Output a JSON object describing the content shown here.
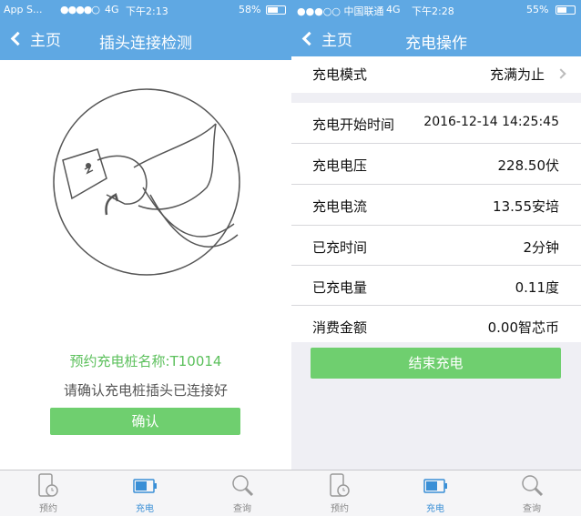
{
  "left": {
    "status": {
      "carrier": "App S...",
      "signal": "●●●●○",
      "network": "4G",
      "time": "下午2:13",
      "battery": "58%"
    },
    "nav": {
      "back_label": "主页",
      "title": "插头连接检测"
    },
    "station_name": "预约充电桩名称:T10014",
    "prompt": "请确认充电桩插头已连接好",
    "confirm_label": "确认",
    "tabs": [
      {
        "label": "预约"
      },
      {
        "label": "充电"
      },
      {
        "label": "查询"
      }
    ]
  },
  "right": {
    "status": {
      "carrier": "●●●○○ 中国联通",
      "network": "4G",
      "time": "下午2:28",
      "battery": "55%"
    },
    "nav": {
      "back_label": "主页",
      "title": "充电操作"
    },
    "mode": {
      "label": "充电模式",
      "value": "充满为止"
    },
    "rows": [
      {
        "label": "充电开始时间",
        "value": "2016-12-14 14:25:45"
      },
      {
        "label": "充电电压",
        "value": "228.50伏"
      },
      {
        "label": "充电电流",
        "value": "13.55安培"
      },
      {
        "label": "已充时间",
        "value": "2分钟"
      },
      {
        "label": "已充电量",
        "value": "0.11度"
      },
      {
        "label": "消费金额",
        "value": "0.00智芯币"
      }
    ],
    "end_label": "结束充电",
    "tabs": [
      {
        "label": "预约"
      },
      {
        "label": "充电"
      },
      {
        "label": "查询"
      }
    ]
  },
  "colors": {
    "header": "#5fa8e3",
    "accent_green": "#6fcf6f",
    "active_tab": "#3a8fd6"
  }
}
